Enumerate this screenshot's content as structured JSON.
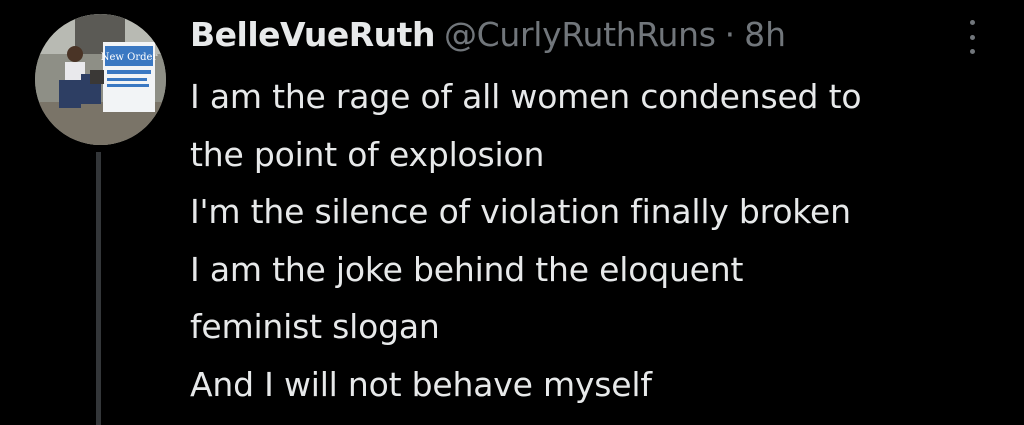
{
  "tweet": {
    "display_name": "BelleVueRuth",
    "handle": "@CurlyRuthRuns",
    "separator": "·",
    "time": "8h",
    "avatar_sign_text": "New Order",
    "text_lines": [
      "I am the rage of all women condensed to",
      "the point of explosion",
      "I'm the silence of violation finally broken",
      "I am the joke behind the eloquent",
      "feminist slogan",
      "And I will not behave myself"
    ]
  },
  "icons": {
    "more": "more-vertical-icon"
  },
  "colors": {
    "background": "#000000",
    "primary_text": "#e7e9ea",
    "secondary_text": "#71767b",
    "thread_line": "#333639"
  }
}
